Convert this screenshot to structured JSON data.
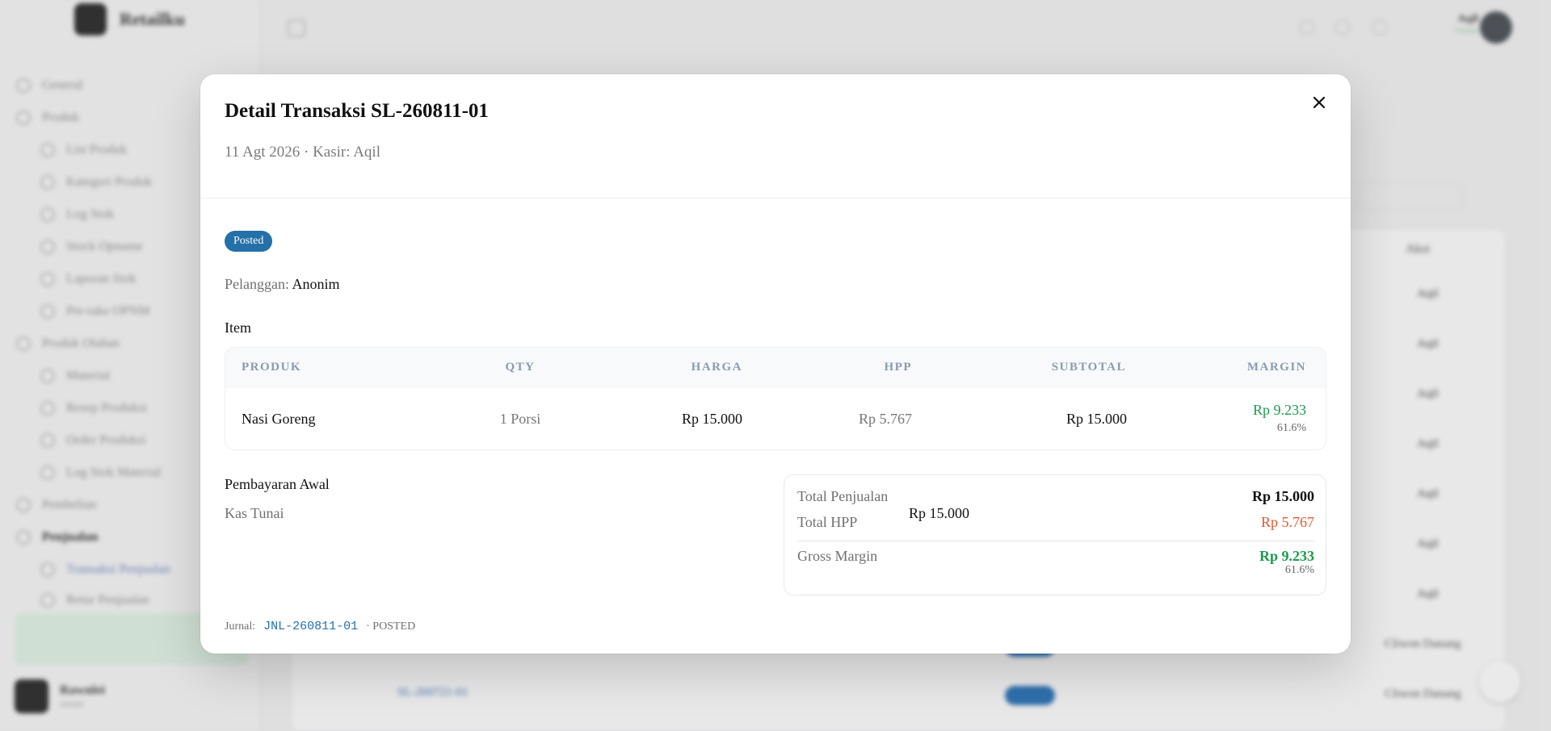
{
  "background": {
    "brand": "Retailku",
    "sidebar": {
      "items": [
        {
          "label": "General"
        },
        {
          "label": "Produk"
        },
        {
          "label": "List Produk"
        },
        {
          "label": "Kategori Produk"
        },
        {
          "label": "Log Stok"
        },
        {
          "label": "Stock Opname"
        },
        {
          "label": "Laporan Stok"
        },
        {
          "label": "Pre-take OPNM"
        },
        {
          "label": "Produk Olahan"
        },
        {
          "label": "Material"
        },
        {
          "label": "Resep Produksi"
        },
        {
          "label": "Order Produksi"
        },
        {
          "label": "Log Stok Material"
        },
        {
          "label": "Pembelian"
        },
        {
          "label": "Penjualan"
        },
        {
          "label": "Transaksi Penjualan"
        },
        {
          "label": "Retur Penjualan"
        }
      ],
      "user_name": "Rawnlei",
      "user_role": "owner"
    },
    "top_user": {
      "name": "Aqil",
      "status": "Online"
    },
    "table_header_aksi": "Aksi",
    "row_values": [
      "Aqil",
      "Aqil",
      "Aqil",
      "Aqil",
      "Aqil",
      "Aqil",
      "Aqil"
    ],
    "row_long_values": [
      "Cliwon Danang",
      "Cliwon Danang"
    ],
    "row_link": "SL-260721-01"
  },
  "modal": {
    "title": "Detail Transaksi SL-260811-01",
    "subtitle": "11 Agt 2026 · Kasir: Aqil",
    "close_label": "Close",
    "status_badge": "Posted",
    "customer_label": "Pelanggan:",
    "customer_value": "Anonim",
    "items_section_label": "Item",
    "items_table": {
      "headers": [
        "PRODUK",
        "QTY",
        "HARGA",
        "HPP",
        "SUBTOTAL",
        "MARGIN"
      ],
      "rows": [
        {
          "produk": "Nasi Goreng",
          "qty": "1 Porsi",
          "harga": "Rp 15.000",
          "hpp": "Rp 5.767",
          "subtotal": "Rp 15.000",
          "margin": "Rp 9.233",
          "margin_pct": "61.6%"
        }
      ]
    },
    "payment": {
      "label": "Pembayaran Awal",
      "method": "Kas Tunai",
      "amount": "Rp 15.000"
    },
    "summary": {
      "total_penjualan_label": "Total Penjualan",
      "total_penjualan_value": "Rp 15.000",
      "total_hpp_label": "Total HPP",
      "total_hpp_value": "Rp 5.767",
      "gross_margin_label": "Gross Margin",
      "gross_margin_value": "Rp 9.233",
      "gross_margin_pct": "61.6%"
    },
    "journal": {
      "label": "Jurnal:",
      "code": "JNL-260811-01",
      "status": "· POSTED"
    }
  },
  "colors": {
    "badge": "#2470a8",
    "margin_green": "#1c9a4e",
    "hpp_orange": "#e4572e",
    "link_blue": "#2470a8"
  }
}
